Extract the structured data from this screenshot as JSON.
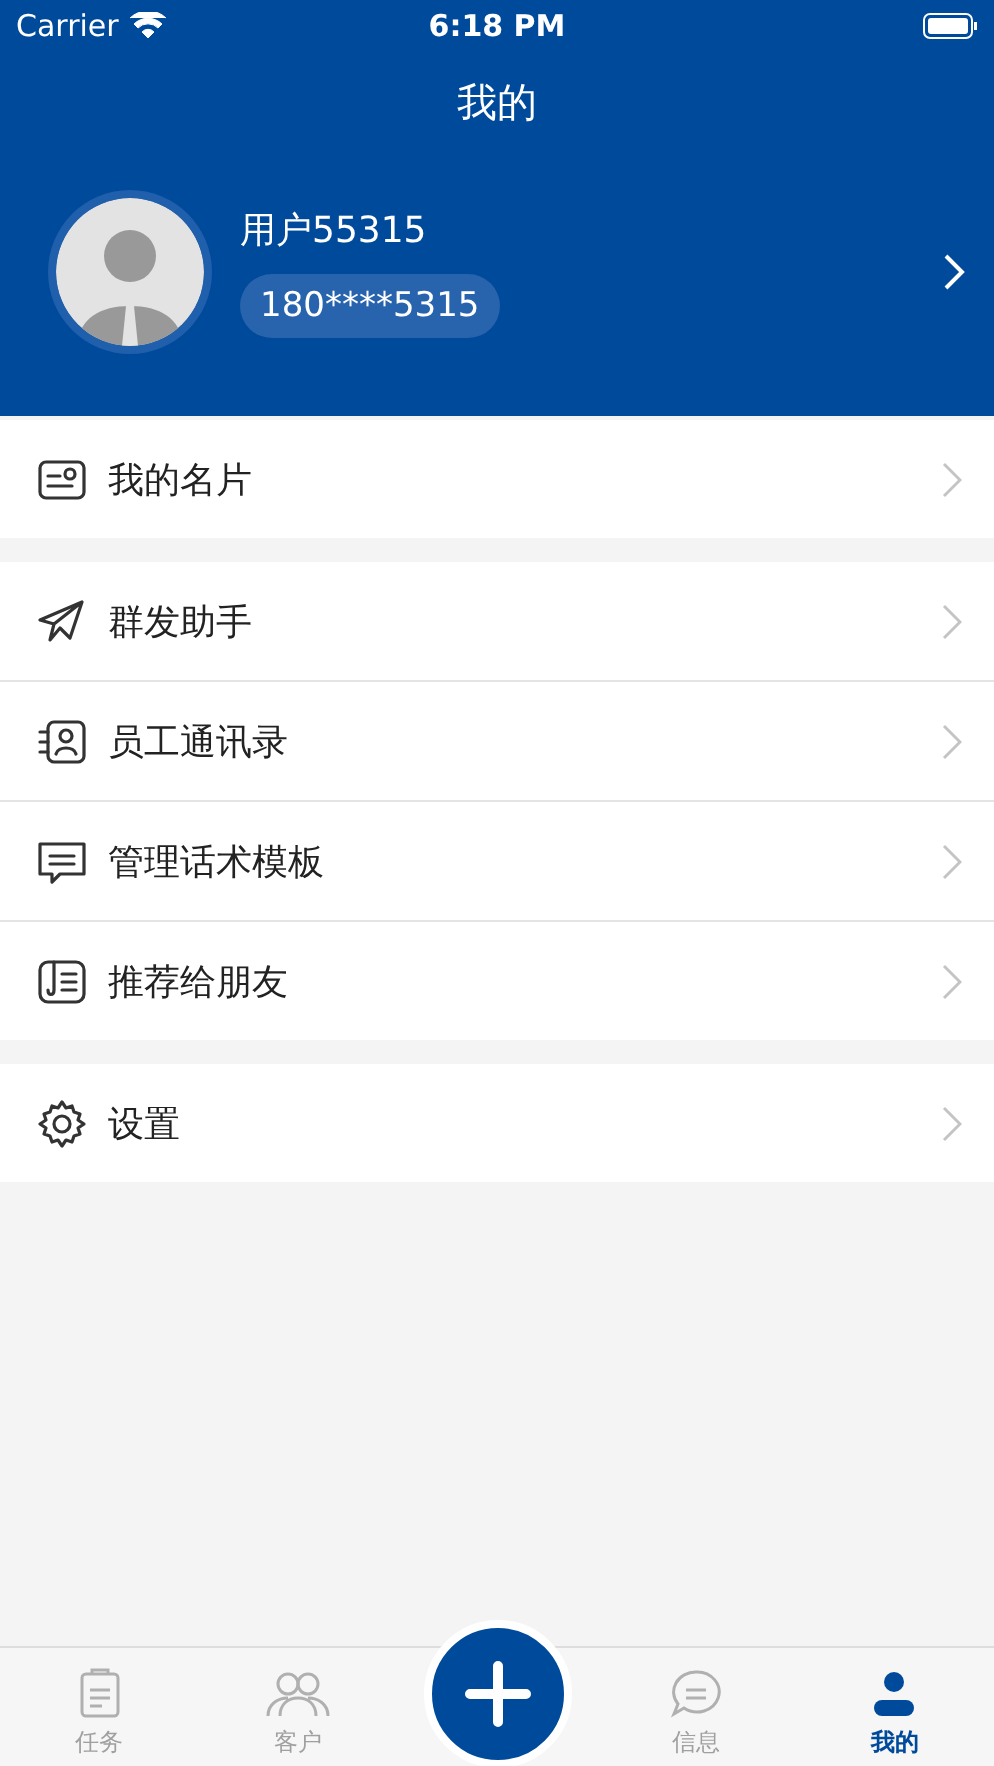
{
  "status_bar": {
    "carrier": "Carrier",
    "time": "6:18 PM"
  },
  "nav": {
    "title": "我的"
  },
  "profile": {
    "name": "用户55315",
    "phone": "180****5315"
  },
  "menu_groups": [
    {
      "items": [
        {
          "label": "我的名片"
        }
      ]
    },
    {
      "items": [
        {
          "label": "群发助手"
        },
        {
          "label": "员工通讯录"
        },
        {
          "label": "管理话术模板"
        },
        {
          "label": "推荐给朋友"
        }
      ]
    },
    {
      "items": [
        {
          "label": "设置"
        }
      ]
    }
  ],
  "tab_bar": [
    {
      "label": "任务",
      "selected": false
    },
    {
      "label": "客户",
      "selected": false
    },
    {
      "kind": "add"
    },
    {
      "label": "信息",
      "selected": false
    },
    {
      "label": "我的",
      "selected": true
    }
  ]
}
